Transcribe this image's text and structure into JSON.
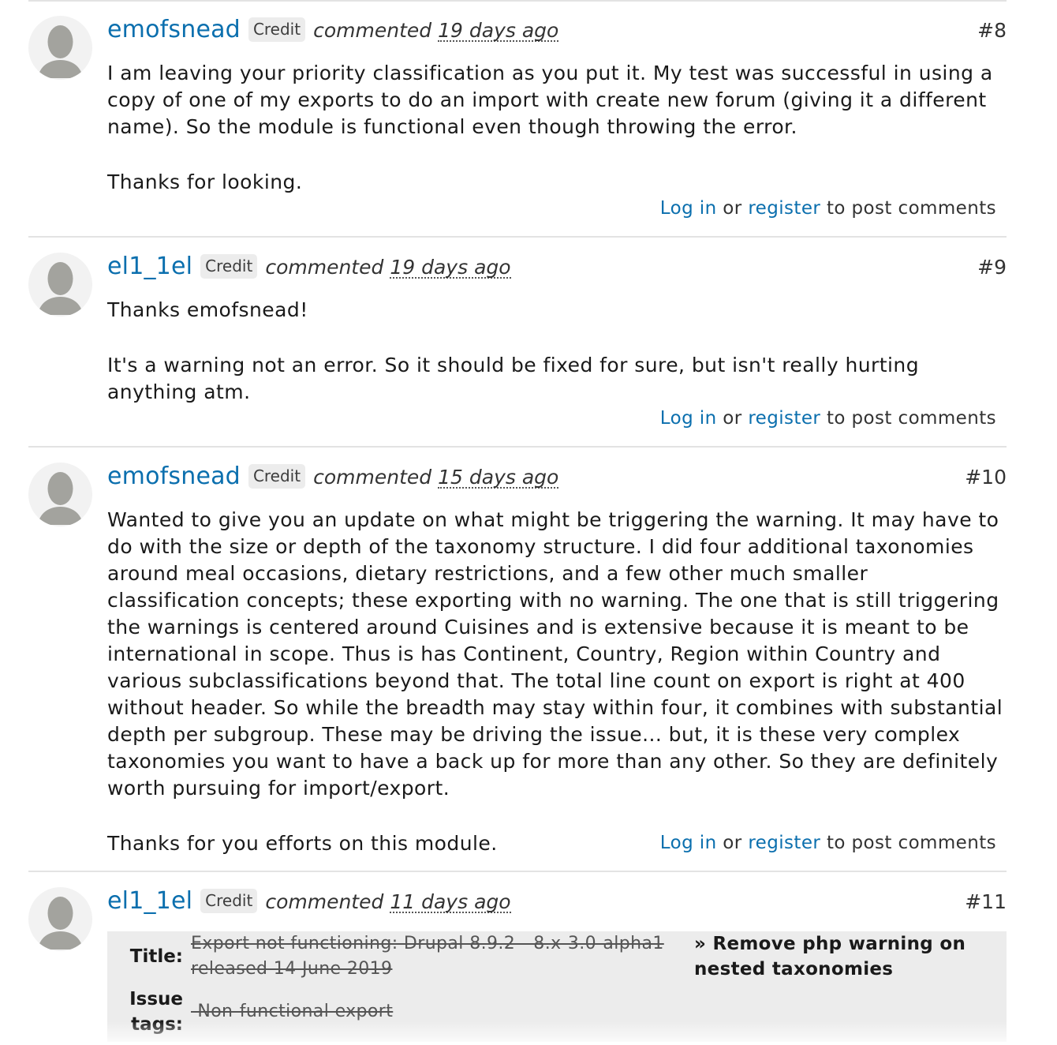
{
  "comments": [
    {
      "author": "emofsnead",
      "credit": "Credit",
      "verb": "commented",
      "time": "19 days ago",
      "number": "#8",
      "paragraphs": [
        "I am leaving your priority classification as you put it. My test was successful in using a copy of one of my exports to do an import with create new forum (giving it a different name). So the module is functional even though throwing the error.",
        "Thanks for looking."
      ],
      "login": "Log in",
      "or": "or",
      "register": "register",
      "post": "to post comments"
    },
    {
      "author": "el1_1el",
      "credit": "Credit",
      "verb": "commented",
      "time": "19 days ago",
      "number": "#9",
      "paragraphs": [
        "Thanks emofsnead!",
        "It's a warning not an error. So it should be fixed for sure, but isn't really hurting anything atm."
      ],
      "login": "Log in",
      "or": "or",
      "register": "register",
      "post": "to post comments"
    },
    {
      "author": "emofsnead",
      "credit": "Credit",
      "verb": "commented",
      "time": "15 days ago",
      "number": "#10",
      "paragraphs": [
        "Wanted to give you an update on what might be triggering the warning. It may have to do with the size or depth of the taxonomy structure. I did four additional taxonomies around meal occasions, dietary restrictions, and a few other much smaller classification concepts; these exporting with no warning. The one that is still triggering the warnings is centered around Cuisines and is extensive because it is meant to be international in scope. Thus is has Continent, Country, Region within Country and various subclassifications beyond that. The total line count on export is right at 400 without header. So while the breadth may stay within four, it combines with substantial depth per subgroup. These may be driving the issue... but, it is these very complex taxonomies you want to have a back up for more than any other. So they are definitely worth pursuing for import/export.",
        "Thanks for you efforts on this module."
      ],
      "login": "Log in",
      "or": "or",
      "register": "register",
      "post": "to post comments"
    },
    {
      "author": "el1_1el",
      "credit": "Credit",
      "verb": "commented",
      "time": "11 days ago",
      "number": "#11",
      "changes": {
        "title_label": "Title:",
        "title_old": "Export not functioning: Drupal 8.9.2 - 8.x-3.0-alpha1 released 14 June 2019",
        "title_new": "» Remove php warning on nested taxonomies",
        "tags_label": "Issue tags:",
        "tags_old": "-Non-functional export"
      }
    }
  ]
}
